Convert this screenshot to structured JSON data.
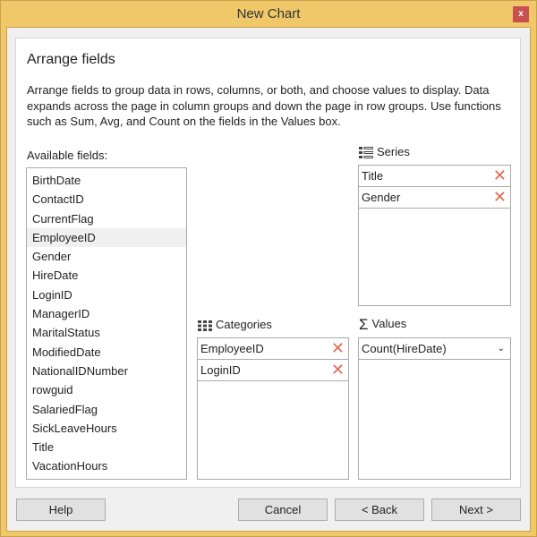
{
  "window": {
    "title": "New Chart",
    "close": "x"
  },
  "heading": "Arrange fields",
  "description": "Arrange fields to group data in rows, columns, or both, and choose values to display. Data expands across the page in column groups and down the page in row groups. Use functions such as Sum, Avg, and Count on the fields in the Values box.",
  "available": {
    "label": "Available fields:",
    "items": [
      "BirthDate",
      "ContactID",
      "CurrentFlag",
      "EmployeeID",
      "Gender",
      "HireDate",
      "LoginID",
      "ManagerID",
      "MaritalStatus",
      "ModifiedDate",
      "NationalIDNumber",
      "rowguid",
      "SalariedFlag",
      "SickLeaveHours",
      "Title",
      "VacationHours"
    ],
    "selected": "EmployeeID"
  },
  "series": {
    "label": "Series",
    "icon": "series-list-icon",
    "items": [
      "Title",
      "Gender"
    ]
  },
  "categories": {
    "label": "Categories",
    "icon": "grid-icon",
    "items": [
      "EmployeeID",
      "LoginID"
    ]
  },
  "values": {
    "label": "Values",
    "icon": "sigma-icon",
    "items": [
      "Count(HireDate)"
    ]
  },
  "buttons": {
    "help": "Help",
    "cancel": "Cancel",
    "back": "< Back",
    "next": "Next >"
  },
  "colors": {
    "titlebar": "#f0c86a",
    "close": "#c75050",
    "remove": "#e06a50"
  }
}
